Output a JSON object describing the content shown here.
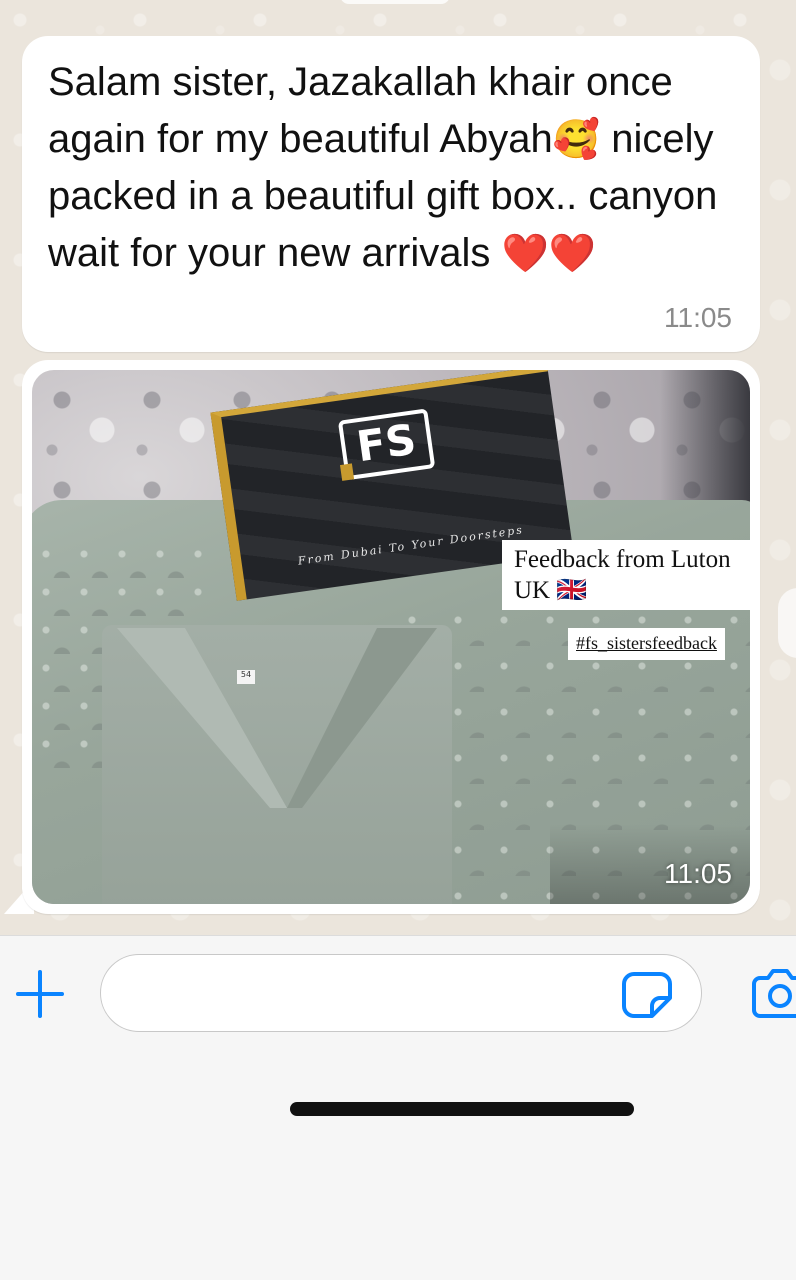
{
  "messages": [
    {
      "text": "Salam sister, Jazakallah khair once again for my beautiful Abyah",
      "emoji_inline": "🥰",
      "text_cont": " nicely packed in a beautiful gift box.. canyon wait for your new arrivals ",
      "emoji_end": "❤️❤️",
      "time": "11:05"
    },
    {
      "image": {
        "box_caption": "From Dubai To Your Doorsteps",
        "box_logo": "FS",
        "overlay_caption": "Feedback from Luton UK 🇬🇧",
        "hashtag": "#fs_sistersfeedback",
        "size_tag": "54"
      },
      "time": "11:05"
    }
  ],
  "composer": {
    "input_value": "",
    "input_placeholder": "",
    "plus_icon": "plus-icon",
    "sticker_icon": "sticker-icon",
    "camera_icon": "camera-icon"
  },
  "colors": {
    "accent": "#0a84ff",
    "bubble": "#ffffff",
    "chat_bg": "#ebe5dc",
    "time_text": "#8a8a8a"
  }
}
